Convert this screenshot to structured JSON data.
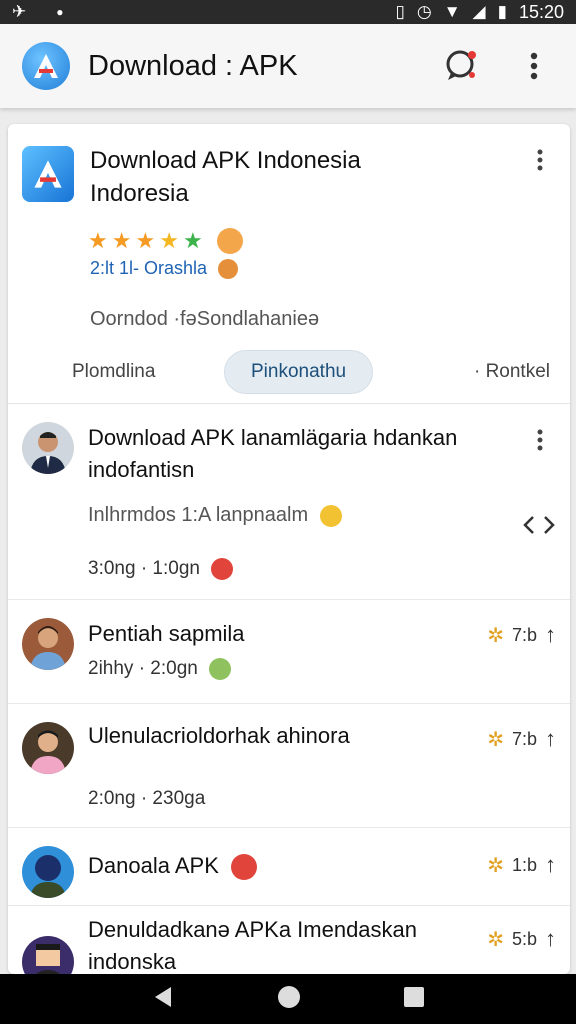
{
  "status_bar": {
    "time": "15:20"
  },
  "app_bar": {
    "title": "Download : APK"
  },
  "app_info": {
    "name_line1": "Download APK Indonesia",
    "name_line2": "Indoresia",
    "rating_stars": 5,
    "meta": "2:lt 1l- Orashla",
    "subtitle": "Oorndod  ·fəSondlahanieə"
  },
  "tabs": [
    {
      "label": "Plomdlina",
      "active": false
    },
    {
      "label": "Pinkonathu",
      "active": true
    },
    {
      "label": "· Rontkel",
      "active": false
    }
  ],
  "posts": [
    {
      "title": "Download APK lanamlägaria hdankan indofantisn",
      "sub": "Inlhrmdos 1:A lanpnaalm",
      "meta": "3:0ng · 1:0gn"
    },
    {
      "title": "Pentiah sapmila",
      "meta": "2ihhy · 2:0gn",
      "right": "7:b"
    },
    {
      "title": "Ulenulaсrioldorhak ahinora",
      "meta": "2:0ng · 230ga",
      "right": "7:b"
    },
    {
      "title": "Danoala APK",
      "right": "1:b"
    },
    {
      "title": "Denuldadkanə APKa Imendaskan indonska",
      "right": "5:b"
    }
  ],
  "colors": {
    "accent": "#1f7fd8",
    "link": "#1f63b5",
    "tab_active_bg": "#e4ecf2"
  }
}
